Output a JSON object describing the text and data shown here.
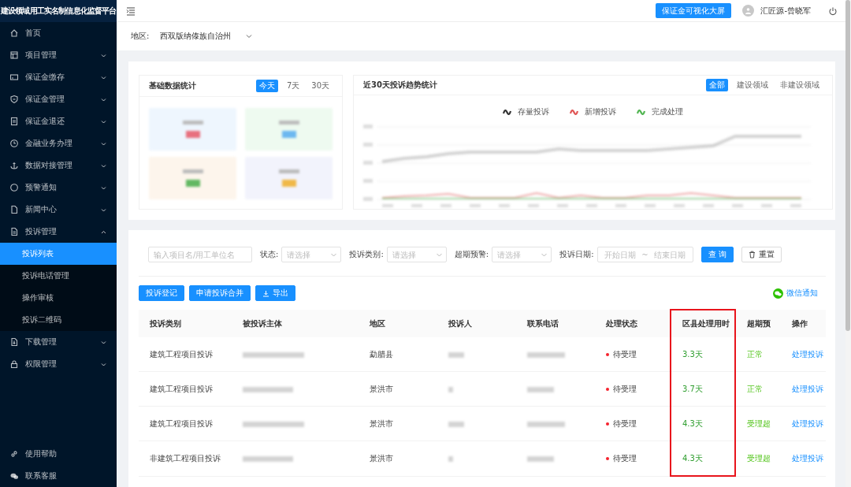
{
  "sidebar": {
    "title": "建设领域用工实名制信息化监督平台",
    "items": [
      {
        "label": "首页",
        "kind": "link"
      },
      {
        "label": "项目管理",
        "kind": "group",
        "expanded": false
      },
      {
        "label": "保证金缴存",
        "kind": "group",
        "expanded": false
      },
      {
        "label": "保证金管理",
        "kind": "group",
        "expanded": false
      },
      {
        "label": "保证金退还",
        "kind": "group",
        "expanded": false
      },
      {
        "label": "金融业务办理",
        "kind": "group",
        "expanded": false
      },
      {
        "label": "数据对接管理",
        "kind": "group",
        "expanded": false
      },
      {
        "label": "预警通知",
        "kind": "group",
        "expanded": false
      },
      {
        "label": "新闻中心",
        "kind": "group",
        "expanded": false
      },
      {
        "label": "投诉管理",
        "kind": "group",
        "expanded": true,
        "children": [
          {
            "label": "投诉列表",
            "selected": true
          },
          {
            "label": "投诉电话管理",
            "selected": false
          },
          {
            "label": "操作审核",
            "selected": false
          },
          {
            "label": "投诉二维码",
            "selected": false
          }
        ]
      },
      {
        "label": "下载管理",
        "kind": "group",
        "expanded": false
      },
      {
        "label": "权限管理",
        "kind": "group",
        "expanded": false
      }
    ],
    "footer": [
      {
        "label": "使用帮助"
      },
      {
        "label": "联系客服"
      }
    ]
  },
  "topbar": {
    "dashboard_button": "保证金可视化大屏",
    "user_name": "汇匠源-曾晓军"
  },
  "region": {
    "label": "地区:",
    "value": "西双版纳傣族自治州"
  },
  "basic_stats": {
    "title": "基础数据统计",
    "tabs": [
      {
        "label": "今天",
        "selected": true
      },
      {
        "label": "7天",
        "selected": false
      },
      {
        "label": "30天",
        "selected": false
      }
    ],
    "tiles": [
      {
        "color": "#e8707e"
      },
      {
        "color": "#6cb8f0"
      },
      {
        "color": "#62b862"
      },
      {
        "color": "#f0b848"
      }
    ]
  },
  "trend": {
    "title": "近30天投诉趋势统计",
    "tabs": [
      {
        "label": "全部",
        "selected": true
      },
      {
        "label": "建设领域",
        "selected": false
      },
      {
        "label": "非建设领域",
        "selected": false
      }
    ],
    "legend": [
      {
        "label": "存量投诉",
        "color": "#333333"
      },
      {
        "label": "新增投诉",
        "color": "#e05555"
      },
      {
        "label": "完成处理",
        "color": "#52b552"
      }
    ]
  },
  "filters": {
    "keyword": {
      "placeholder": "输入项目名/用工单位名"
    },
    "selects": [
      {
        "label": "状态:",
        "placeholder": "请选择"
      },
      {
        "label": "投诉类别:",
        "placeholder": "请选择"
      },
      {
        "label": "超期预警:",
        "placeholder": "请选择"
      }
    ],
    "date": {
      "label": "投诉日期:",
      "start_placeholder": "开始日期",
      "separator": "~",
      "end_placeholder": "结束日期"
    },
    "search_button": "查 询",
    "reset_button": "重置"
  },
  "actions": {
    "buttons": [
      {
        "label": "投诉登记",
        "kind": "plain"
      },
      {
        "label": "申请投诉合并",
        "kind": "plain"
      },
      {
        "label": "导出",
        "kind": "download"
      }
    ],
    "wechat_link": "微信通知"
  },
  "table": {
    "columns": [
      {
        "label": "投诉类别",
        "kind": "category",
        "highlighted": false
      },
      {
        "label": "被投诉主体",
        "kind": "redacted",
        "highlighted": false
      },
      {
        "label": "地区",
        "kind": "region",
        "highlighted": false
      },
      {
        "label": "投诉人",
        "kind": "redacted",
        "highlighted": false
      },
      {
        "label": "联系电话",
        "kind": "redacted",
        "highlighted": false
      },
      {
        "label": "处理状态",
        "kind": "status",
        "highlighted": false
      },
      {
        "label": "区县处理用时",
        "kind": "duration",
        "highlighted": true
      },
      {
        "label": "超期预",
        "kind": "warning",
        "highlighted": false
      },
      {
        "label": "操作",
        "kind": "action",
        "highlighted": false
      }
    ],
    "rows": [
      {
        "category": "建筑工程项目投诉",
        "region": "勐腊县",
        "status": "待受理",
        "duration": "3.3天",
        "warning": "正常",
        "action": "处理投诉"
      },
      {
        "category": "建筑工程项目投诉",
        "region": "景洪市",
        "status": "待受理",
        "duration": "3.7天",
        "warning": "正常",
        "action": "处理投诉"
      },
      {
        "category": "建筑工程项目投诉",
        "region": "景洪市",
        "status": "待受理",
        "duration": "4.3天",
        "warning": "受理超",
        "action": "处理投诉"
      },
      {
        "category": "非建筑工程项目投诉",
        "region": "景洪市",
        "status": "待受理",
        "duration": "4.3天",
        "warning": "受理超",
        "action": "处理投诉"
      }
    ]
  }
}
